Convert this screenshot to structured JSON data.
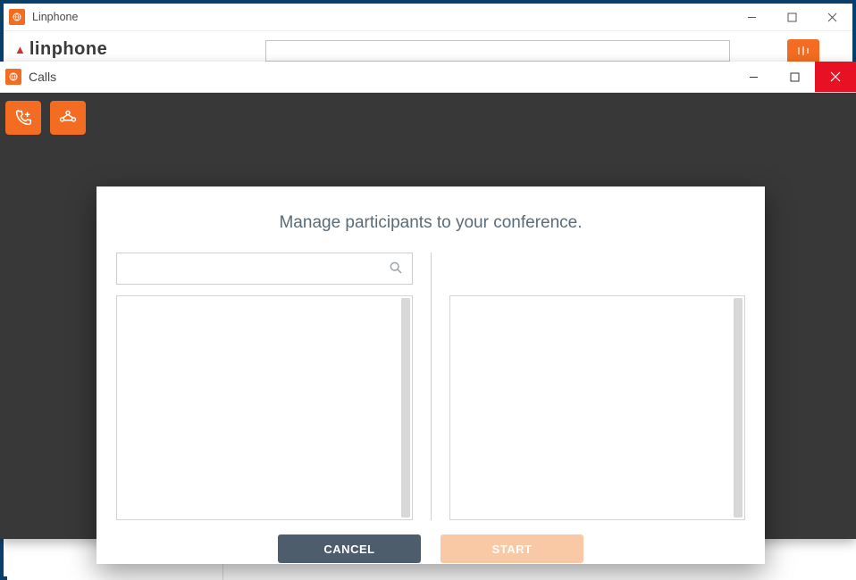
{
  "main_window": {
    "title": "Linphone",
    "app_name": "linphone"
  },
  "calls_window": {
    "title": "Calls"
  },
  "modal": {
    "heading": "Manage participants to your conference.",
    "search_placeholder": "",
    "cancel_label": "CANCEL",
    "start_label": "START"
  },
  "colors": {
    "accent": "#f36c21",
    "close_red": "#e81123",
    "cancel_btn": "#4e5d6c",
    "start_btn": "#f9c9a5"
  }
}
